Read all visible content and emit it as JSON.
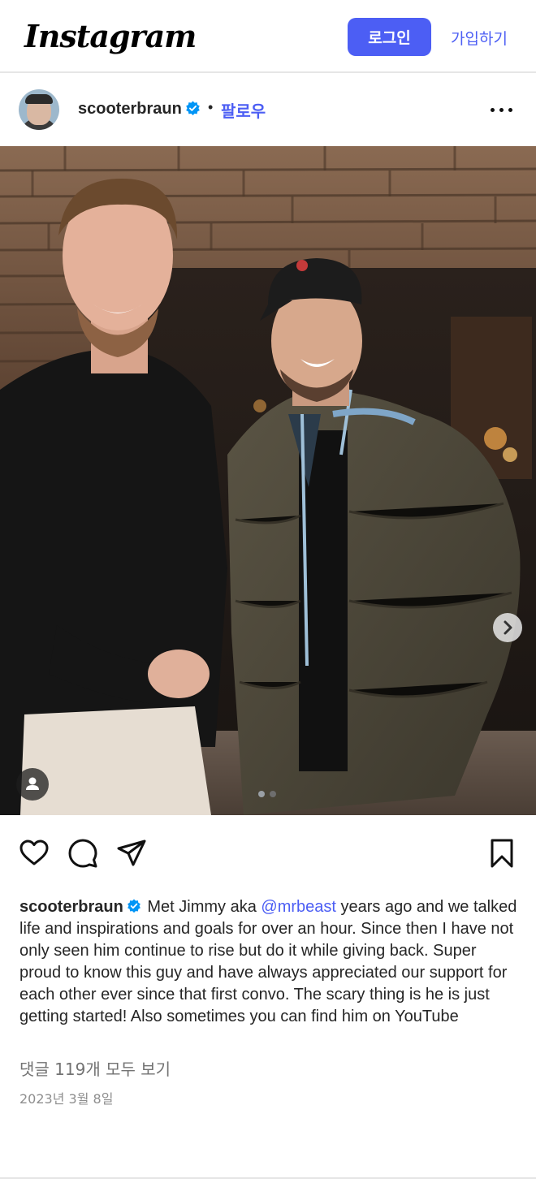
{
  "topbar": {
    "logo_text": "Instagram",
    "login_label": "로그인",
    "signup_label": "가입하기"
  },
  "post": {
    "username": "scooterbraun",
    "verified": true,
    "separator": "•",
    "follow_label": "팔로우",
    "more_icon": "more-horizontal-icon",
    "carousel": {
      "current_index": 1,
      "total": 2,
      "next_icon": "chevron-right-icon",
      "tag_icon": "user-tag-icon"
    },
    "actions": {
      "like_icon": "heart-icon",
      "comment_icon": "comment-icon",
      "share_icon": "send-icon",
      "save_icon": "bookmark-icon"
    },
    "caption": {
      "username": "scooterbraun",
      "before_mention": " Met Jimmy aka ",
      "mention": "@mrbeast",
      "after_mention": " years ago and we talked life and inspirations and goals for over an hour. Since then I have not only seen him continue to rise but do it while giving back. Super proud to know this guy and have always appreciated our support for each other ever since that first convo. The scary thing is he is just getting started! Also sometimes you can find him on YouTube"
    },
    "comments_label": "댓글 119개 모두 보기",
    "date": "2023년 3월 8일"
  },
  "colors": {
    "accent": "#4c5ef4",
    "verified": "#0095f6",
    "text": "#262626",
    "muted": "#737373"
  }
}
